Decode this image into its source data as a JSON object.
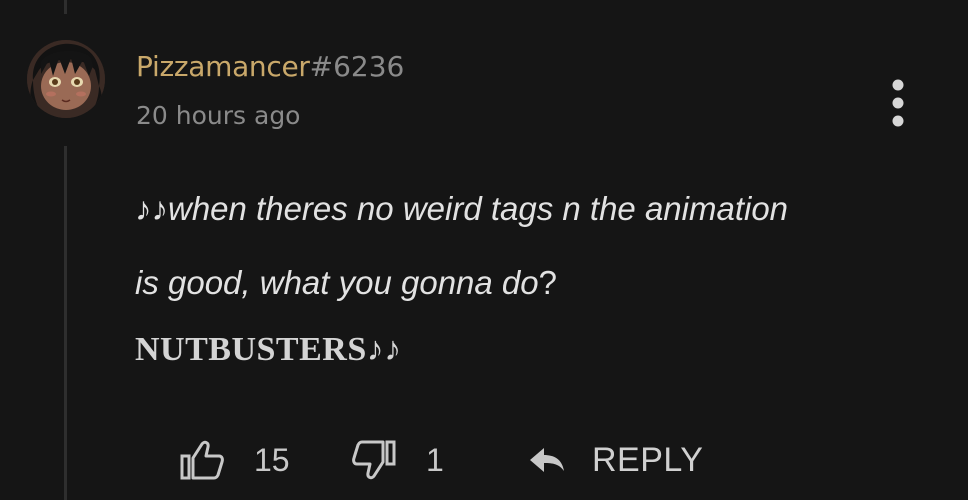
{
  "comment": {
    "author": "Pizzamancer",
    "discriminator": "#6236",
    "timestamp": "20 hours ago",
    "body_lines": [
      "♪♪when theres no weird tags n the animation",
      "is good, what you gonna do",
      "?",
      "NUTBUSTERS♪♪"
    ]
  },
  "actions": {
    "like_count": "15",
    "dislike_count": "1",
    "reply_label": "REPLY"
  },
  "icons": {
    "menu": "more-vertical-icon",
    "like": "thumbs-up-icon",
    "dislike": "thumbs-down-icon",
    "reply": "reply-arrow-icon"
  },
  "colors": {
    "background": "#151515",
    "username": "#c9a86a",
    "muted": "#8a8a8a",
    "text": "#e2e2e2"
  }
}
